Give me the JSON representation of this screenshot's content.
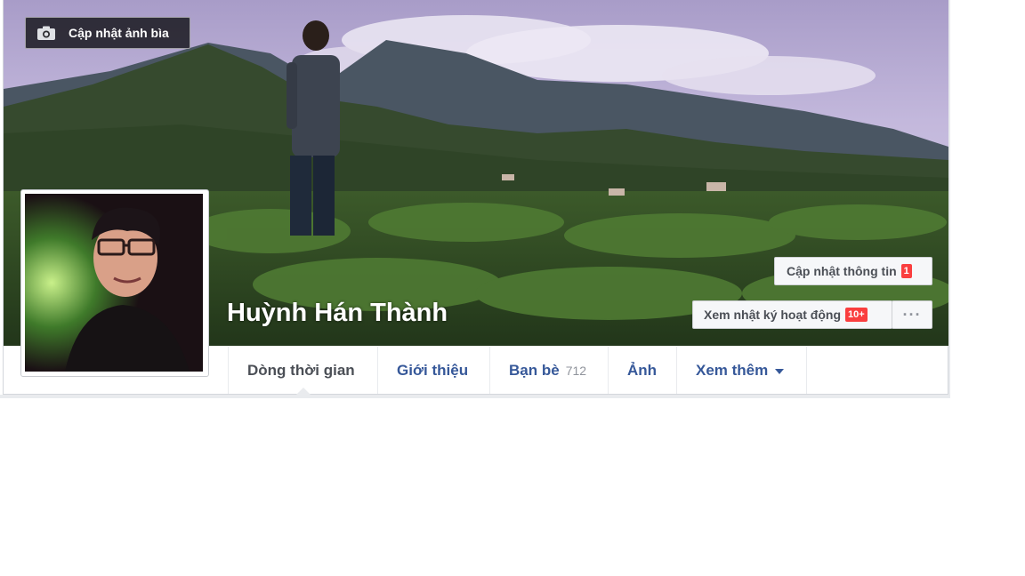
{
  "cover": {
    "update_cover_label": "Cập nhật ảnh bìa"
  },
  "profile": {
    "name": "Huỳnh Hán Thành"
  },
  "actions": {
    "update_info_label": "Cập nhật thông tin",
    "update_info_badge": "1",
    "activity_log_label": "Xem nhật ký hoạt động",
    "activity_log_badge": "10+",
    "more_label": "···"
  },
  "tabs": [
    {
      "label": "Dòng thời gian",
      "active": true
    },
    {
      "label": "Giới thiệu"
    },
    {
      "label": "Bạn bè",
      "count": "712"
    },
    {
      "label": "Ảnh"
    },
    {
      "label": "Xem thêm",
      "has_dropdown": true
    }
  ],
  "colors": {
    "link": "#365899",
    "badge": "#fa3e3e",
    "active_tab": "#4b4f56"
  },
  "icons": [
    "camera-icon",
    "more-icon",
    "chevron-down-icon"
  ]
}
